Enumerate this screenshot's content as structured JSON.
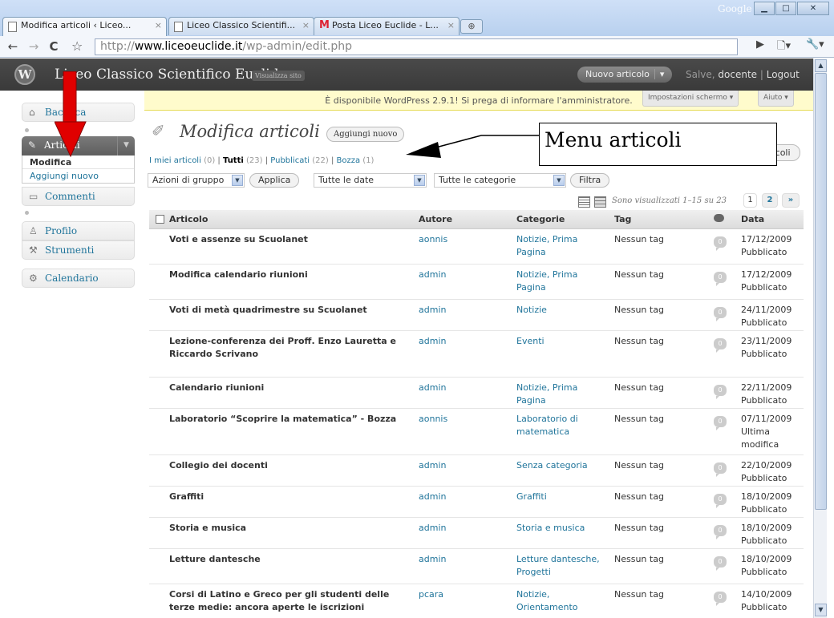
{
  "browser": {
    "tabs": [
      {
        "title": "Modifica articoli ‹ Liceo...",
        "close": "×"
      },
      {
        "title": "Liceo Classico Scientifi...",
        "close": "×"
      },
      {
        "title": "Posta Liceo Euclide - L...",
        "close": "×"
      }
    ],
    "google_label": "Google",
    "url_prefix": "http://",
    "url_domain": "www.liceoeuclide.it",
    "url_path": "/wp-admin/edit.php"
  },
  "wp": {
    "site_name": "Liceo Classico Scientifico Euclide",
    "visit_site": "Visualizza sito",
    "new_post": "Nuovo articolo",
    "greeting_prefix": "Salve, ",
    "user": "docente",
    "logout": "Logout"
  },
  "sidebar": {
    "dashboard": "Bacheca",
    "posts": "Articoli",
    "submenu": [
      "Modifica",
      "Aggiungi nuovo"
    ],
    "comments": "Commenti",
    "profile": "Profilo",
    "tools": "Strumenti",
    "calendar": "Calendario"
  },
  "nag": "È disponibile WordPress 2.9.1! Si prega di informare l'amministratore.",
  "screen_options": "Impostazioni schermo",
  "help": "Aiuto",
  "page_title": "Modifica articoli",
  "add_new": "Aggiungi nuovo",
  "filter_links": {
    "mine": "I miei articoli",
    "mine_count": "(0)",
    "all": "Tutti",
    "all_count": "(23)",
    "published": "Pubblicati",
    "published_count": "(22)",
    "draft": "Bozza",
    "draft_count": "(1)"
  },
  "search_button": "Cerca articoli",
  "bulk_actions": "Azioni di gruppo",
  "apply": "Applica",
  "all_dates": "Tutte le date",
  "all_categories": "Tutte le categorie",
  "filter": "Filtra",
  "displaying": "Sono visualizzati 1–15 su 23",
  "pages": [
    "1",
    "2",
    "»"
  ],
  "columns": {
    "title": "Articolo",
    "author": "Autore",
    "categories": "Categorie",
    "tags": "Tag",
    "date": "Data"
  },
  "posts": [
    {
      "title": "Voti e assenze su Scuolanet",
      "author": "aonnis",
      "cats": [
        "Notizie, Prima",
        "Pagina"
      ],
      "tags": "Nessun tag",
      "comments": "0",
      "date": "17/12/2009",
      "status": [
        "Pubblicato"
      ]
    },
    {
      "title": "Modifica calendario riunioni",
      "author": "admin",
      "cats": [
        "Notizie, Prima",
        "Pagina"
      ],
      "tags": "Nessun tag",
      "comments": "0",
      "date": "17/12/2009",
      "status": [
        "Pubblicato"
      ]
    },
    {
      "title": "Voti di metà quadrimestre su Scuolanet",
      "author": "admin",
      "cats": [
        "Notizie"
      ],
      "tags": "Nessun tag",
      "comments": "0",
      "date": "24/11/2009",
      "status": [
        "Pubblicato"
      ]
    },
    {
      "title": "Lezione-conferenza dei Proff. Enzo Lauretta e Riccardo Scrivano",
      "author": "admin",
      "cats": [
        "Eventi"
      ],
      "tags": "Nessun tag",
      "comments": "0",
      "date": "23/11/2009",
      "status": [
        "Pubblicato"
      ]
    },
    {
      "title": "Calendario riunioni",
      "author": "admin",
      "cats": [
        "Notizie, Prima",
        "Pagina"
      ],
      "tags": "Nessun tag",
      "comments": "0",
      "date": "22/11/2009",
      "status": [
        "Pubblicato"
      ]
    },
    {
      "title": "Laboratorio “Scoprire la matematica” - Bozza",
      "author": "aonnis",
      "cats": [
        "Laboratorio di",
        "matematica"
      ],
      "tags": "Nessun tag",
      "comments": "0",
      "date": "07/11/2009",
      "status": [
        "Ultima",
        "modifica"
      ]
    },
    {
      "title": "Collegio dei docenti",
      "author": "admin",
      "cats": [
        "Senza categoria"
      ],
      "tags": "Nessun tag",
      "comments": "0",
      "date": "22/10/2009",
      "status": [
        "Pubblicato"
      ]
    },
    {
      "title": "Graffiti",
      "author": "admin",
      "cats": [
        "Graffiti"
      ],
      "tags": "Nessun tag",
      "comments": "0",
      "date": "18/10/2009",
      "status": [
        "Pubblicato"
      ]
    },
    {
      "title": "Storia e musica",
      "author": "admin",
      "cats": [
        "Storia e musica"
      ],
      "tags": "Nessun tag",
      "comments": "0",
      "date": "18/10/2009",
      "status": [
        "Pubblicato"
      ]
    },
    {
      "title": "Letture dantesche",
      "author": "admin",
      "cats": [
        "Letture dantesche,",
        "Progetti"
      ],
      "tags": "Nessun tag",
      "comments": "0",
      "date": "18/10/2009",
      "status": [
        "Pubblicato"
      ]
    },
    {
      "title": "Corsi di Latino e Greco per gli studenti delle terze medie: ancora aperte le iscrizioni",
      "author": "pcara",
      "cats": [
        "Notizie,",
        "Orientamento"
      ],
      "tags": "Nessun tag",
      "comments": "0",
      "date": "14/10/2009",
      "status": [
        "Pubblicato"
      ]
    }
  ],
  "annotation": "Menu articoli",
  "colors": {
    "link": "#21759b",
    "nag_bg": "#fffbcc",
    "header_bg": "#464646",
    "annot_arrow": "#cc0000"
  }
}
